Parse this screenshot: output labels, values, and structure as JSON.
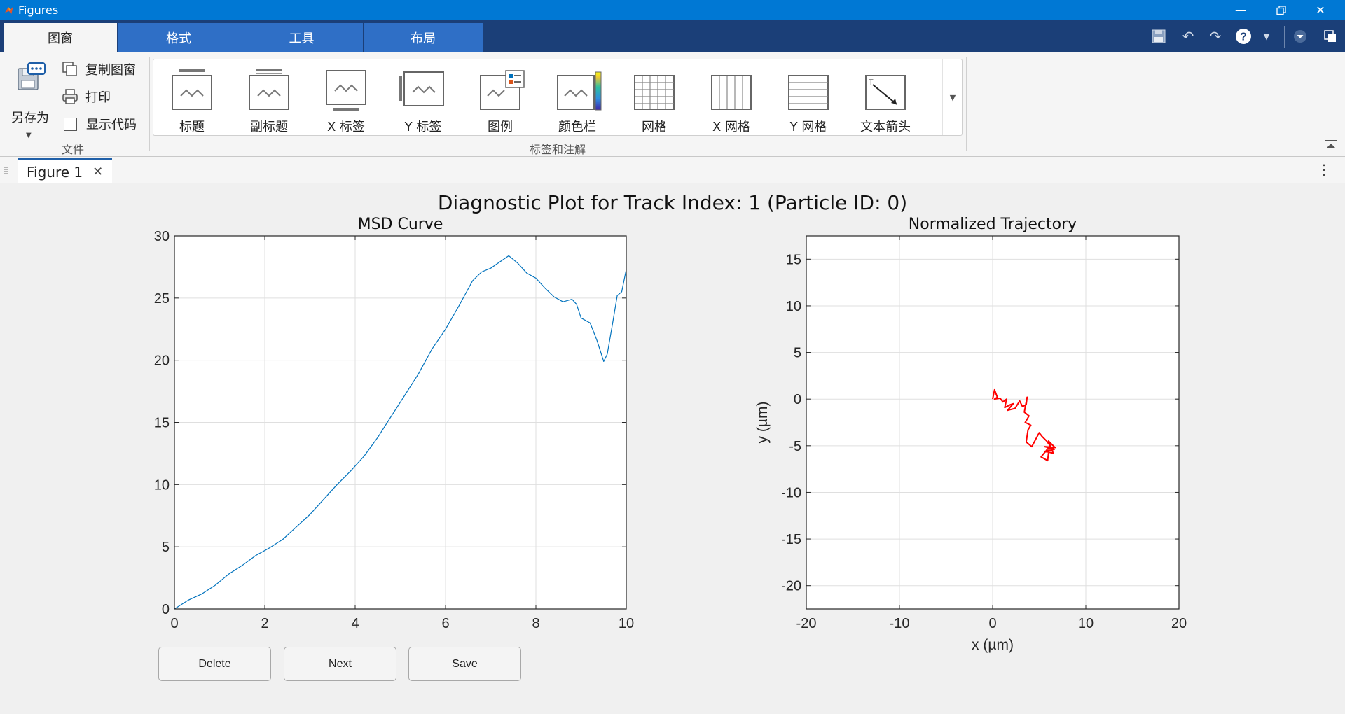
{
  "window": {
    "title": "Figures"
  },
  "tabs": [
    {
      "label": "图窗",
      "active": true
    },
    {
      "label": "格式",
      "active": false
    },
    {
      "label": "工具",
      "active": false
    },
    {
      "label": "布局",
      "active": false
    }
  ],
  "ribbon": {
    "file_group": {
      "save_as_label": "另存为",
      "copy_label": "复制图窗",
      "print_label": "打印",
      "show_code_label": "显示代码",
      "show_code_checked": false,
      "group_label": "文件"
    },
    "annotation_group": {
      "group_label": "标签和注解",
      "buttons": [
        {
          "label": "标题",
          "icon": "title-icon"
        },
        {
          "label": "副标题",
          "icon": "subtitle-icon"
        },
        {
          "label": "X 标签",
          "icon": "xlabel-icon"
        },
        {
          "label": "Y 标签",
          "icon": "ylabel-icon"
        },
        {
          "label": "图例",
          "icon": "legend-icon"
        },
        {
          "label": "颜色栏",
          "icon": "colorbar-icon"
        },
        {
          "label": "网格",
          "icon": "grid-icon"
        },
        {
          "label": "X 网格",
          "icon": "xgrid-icon"
        },
        {
          "label": "Y 网格",
          "icon": "ygrid-icon"
        },
        {
          "label": "文本箭头",
          "icon": "text-arrow-icon"
        }
      ]
    }
  },
  "figure_tab": {
    "label": "Figure 1"
  },
  "figure": {
    "suptitle": "Diagnostic Plot for Track Index: 1 (Particle ID: 0)",
    "buttons": {
      "delete": "Delete",
      "next": "Next",
      "save": "Save"
    }
  },
  "colors": {
    "accent": "#0078d4",
    "msd_line": "#0072bd",
    "trajectory": "#ff0000"
  },
  "chart_data": [
    {
      "type": "line",
      "title": "MSD Curve",
      "xlabel": "",
      "ylabel": "",
      "xlim": [
        0,
        10
      ],
      "ylim": [
        0,
        30
      ],
      "xticks": [
        0,
        2,
        4,
        6,
        8,
        10
      ],
      "yticks": [
        0,
        5,
        10,
        15,
        20,
        25,
        30
      ],
      "grid": true,
      "series": [
        {
          "color": "#0072bd",
          "x": [
            0,
            0.3,
            0.6,
            0.9,
            1.2,
            1.5,
            1.8,
            2.1,
            2.4,
            2.7,
            3.0,
            3.3,
            3.6,
            3.9,
            4.2,
            4.5,
            4.8,
            5.1,
            5.4,
            5.7,
            6.0,
            6.3,
            6.6,
            6.8,
            7.0,
            7.2,
            7.4,
            7.6,
            7.8,
            8.0,
            8.2,
            8.4,
            8.6,
            8.8,
            8.9,
            9.0,
            9.2,
            9.35,
            9.5,
            9.58,
            9.7,
            9.8,
            9.9,
            10.0
          ],
          "y": [
            0,
            0.7,
            1.2,
            1.9,
            2.8,
            3.5,
            4.3,
            4.9,
            5.6,
            6.6,
            7.6,
            8.8,
            10.0,
            11.1,
            12.3,
            13.8,
            15.5,
            17.2,
            18.9,
            20.9,
            22.5,
            24.4,
            26.4,
            27.1,
            27.4,
            27.9,
            28.4,
            27.8,
            27.0,
            26.6,
            25.8,
            25.1,
            24.7,
            24.9,
            24.5,
            23.4,
            23.0,
            21.6,
            19.9,
            20.5,
            23.0,
            25.2,
            25.5,
            27.3
          ]
        }
      ]
    },
    {
      "type": "line",
      "title": "Normalized Trajectory",
      "xlabel": "x (µm)",
      "ylabel": "y (µm)",
      "xlim": [
        -20,
        20
      ],
      "ylim": [
        -22.5,
        17.5
      ],
      "xticks": [
        -20,
        -10,
        0,
        10,
        20
      ],
      "yticks": [
        -20,
        -15,
        -10,
        -5,
        0,
        5,
        10,
        15
      ],
      "grid": true,
      "series": [
        {
          "color": "#ff0000",
          "x": [
            0,
            0.2,
            0.5,
            0.2,
            0.8,
            1.1,
            1.5,
            1.3,
            1.9,
            2.2,
            1.6,
            2.4,
            2.9,
            3.2,
            3.6,
            3.7,
            3.4,
            3.9,
            3.5,
            4.1,
            3.8,
            3.6,
            4.2,
            5.0,
            5.3,
            5.8,
            6.4,
            5.6,
            6.7,
            6.0,
            6.5,
            5.6,
            6.6,
            6.1,
            5.2,
            5.9,
            6.1
          ],
          "y": [
            0,
            1.0,
            0.2,
            0.0,
            0.1,
            -0.3,
            0.0,
            -0.9,
            -0.6,
            -0.5,
            -1.2,
            -1.0,
            -0.2,
            -0.8,
            -0.6,
            0.2,
            -1.4,
            -1.8,
            -2.5,
            -2.8,
            -3.3,
            -4.6,
            -5.1,
            -3.6,
            -4.0,
            -4.5,
            -5.3,
            -5.1,
            -5.2,
            -4.5,
            -5.8,
            -5.6,
            -5.4,
            -5.1,
            -6.2,
            -6.6,
            -4.9
          ]
        }
      ]
    }
  ]
}
